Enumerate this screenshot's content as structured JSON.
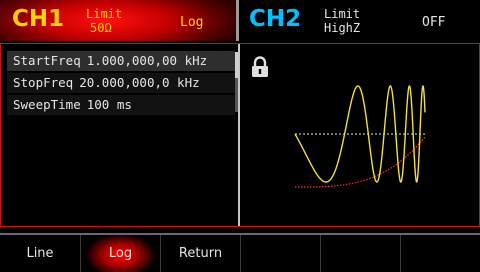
{
  "ch1": {
    "title": "CH1",
    "limit_label": "Limit",
    "limit_value": "50Ω",
    "mode": "Log"
  },
  "ch2": {
    "title": "CH2",
    "limit_label": "Limit",
    "limit_value": "HighZ",
    "state": "OFF"
  },
  "params": [
    {
      "name": "StartFreq",
      "value": "1.000,000,00 kHz"
    },
    {
      "name": "StopFreq",
      "value": "20.000,000,0 kHz"
    },
    {
      "name": "SweepTime",
      "value": "100 ms"
    }
  ],
  "softkeys": [
    "Line",
    "Log",
    "Return",
    "",
    "",
    ""
  ],
  "colors": {
    "ch1_accent": "#ffd400",
    "ch2_accent": "#00c0ff",
    "active_bg": "#d00000",
    "waveform": "#f0e040",
    "sweep_ramp": "#ff3030"
  },
  "icons": {
    "lock": "lock-icon"
  }
}
